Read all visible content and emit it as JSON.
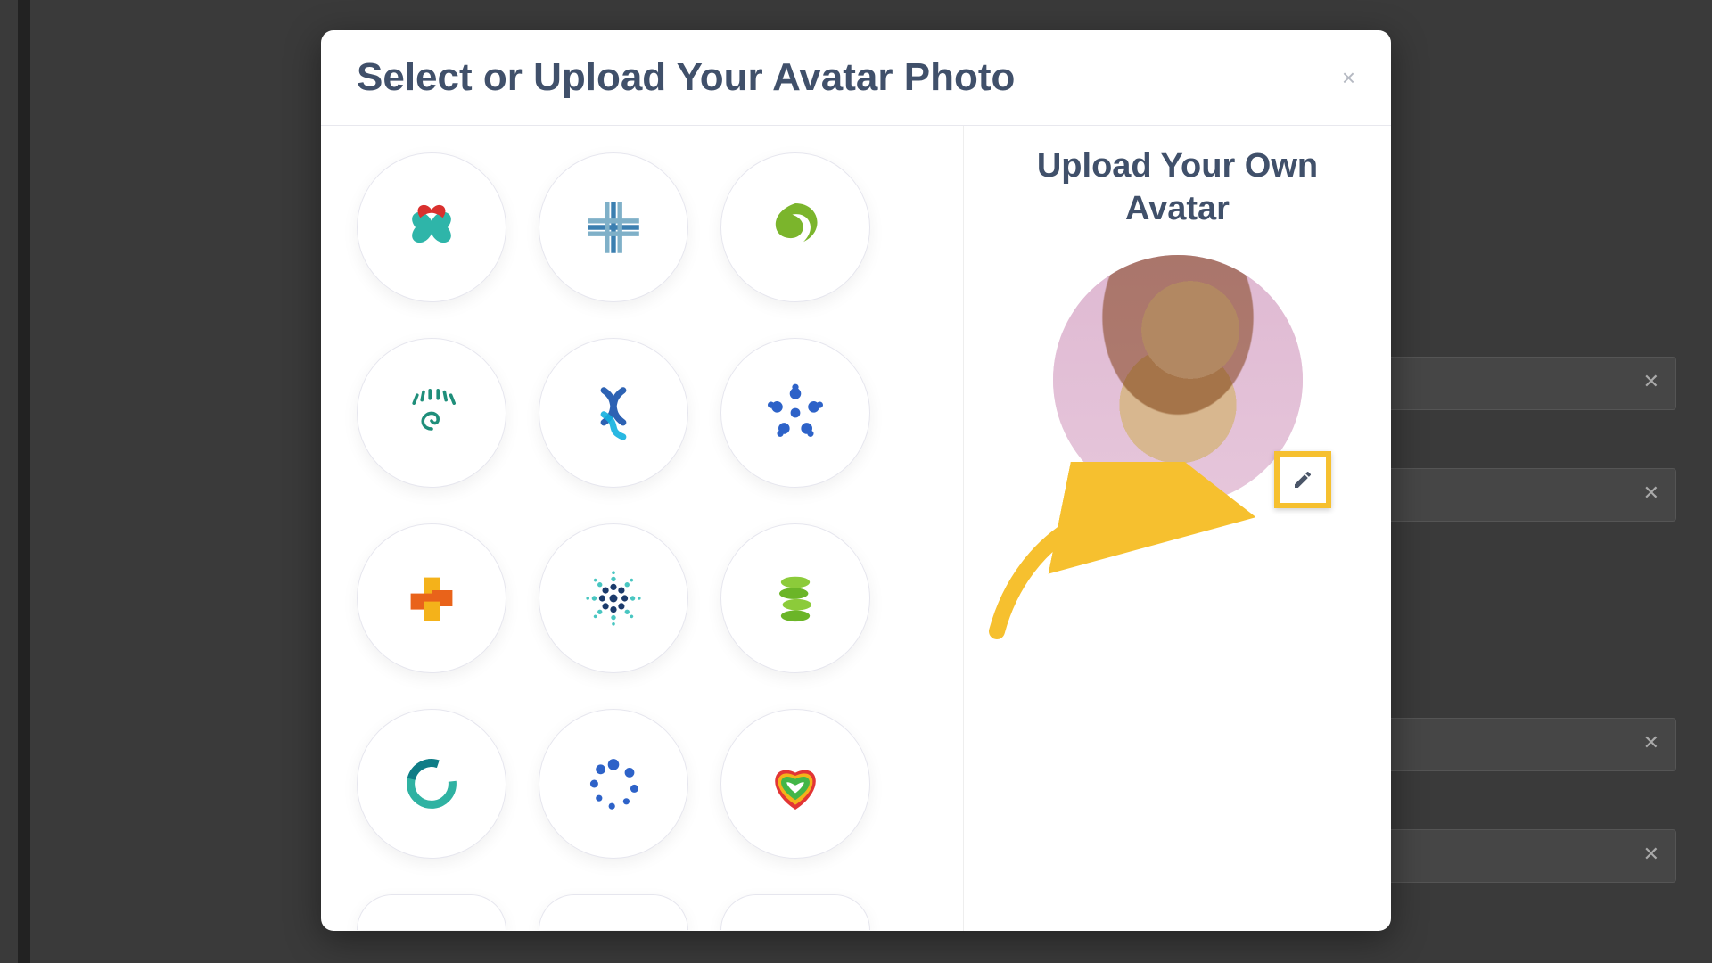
{
  "modal": {
    "title": "Select or Upload Your Avatar Photo",
    "close_glyph": "×",
    "upload_title": "Upload Your Own Avatar"
  },
  "avatars": [
    {
      "name": "clover-heart"
    },
    {
      "name": "medical-plus"
    },
    {
      "name": "leaf-swirl"
    },
    {
      "name": "eye-spiral"
    },
    {
      "name": "dna-strand"
    },
    {
      "name": "atom-star"
    },
    {
      "name": "cross-blocks"
    },
    {
      "name": "dot-burst"
    },
    {
      "name": "spine-stack"
    },
    {
      "name": "ring-teal"
    },
    {
      "name": "dot-loop"
    },
    {
      "name": "rainbow-heart"
    }
  ]
}
